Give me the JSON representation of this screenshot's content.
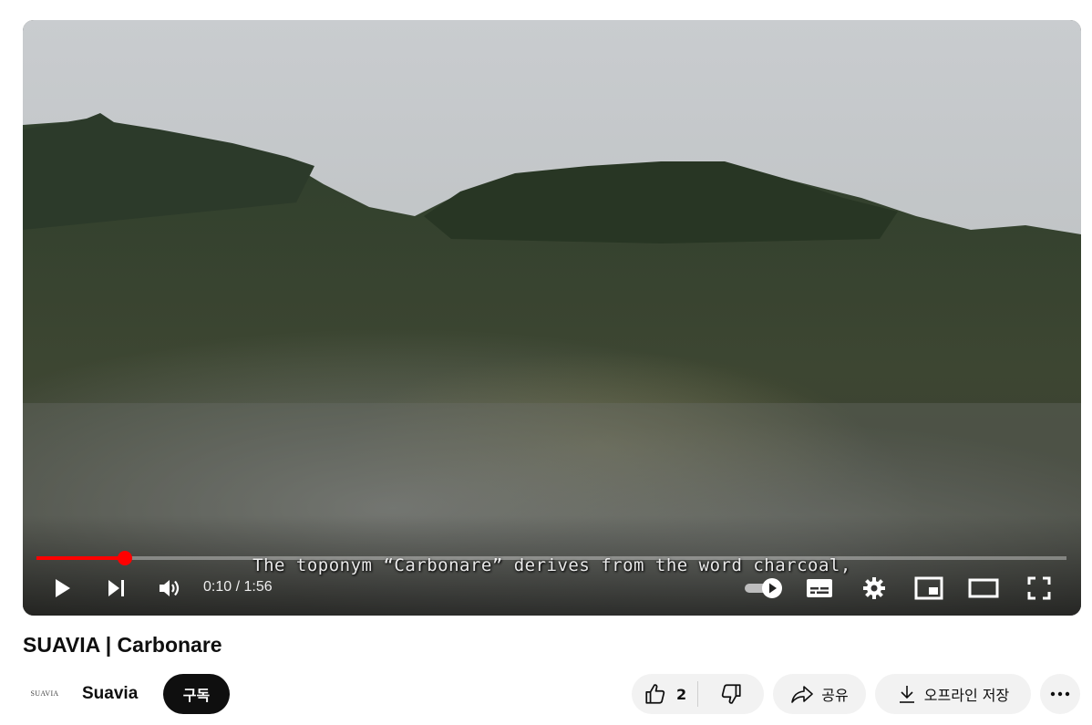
{
  "player": {
    "caption": "The toponym “Carbonare” derives from the word charcoal,",
    "time_display": "0:10 / 1:56",
    "progress_fraction": 0.0862,
    "accent_color": "#ff0000",
    "controls": {
      "play_icon": "play-icon",
      "next_icon": "skip-next-icon",
      "volume_icon": "volume-icon",
      "autoplay_icon": "autoplay-toggle-icon",
      "subtitles_icon": "subtitles-icon",
      "settings_icon": "gear-icon",
      "miniplayer_icon": "miniplayer-icon",
      "theater_icon": "theater-mode-icon",
      "fullscreen_icon": "fullscreen-icon"
    }
  },
  "video": {
    "title": "SUAVIA | Carbonare"
  },
  "channel": {
    "avatar_text": "SUAVIA",
    "name": "Suavia",
    "subscribe_label": "구독"
  },
  "actions": {
    "like_count": "2",
    "share_label": "공유",
    "download_label": "오프라인 저장",
    "more_icon": "more-horizontal-icon"
  }
}
